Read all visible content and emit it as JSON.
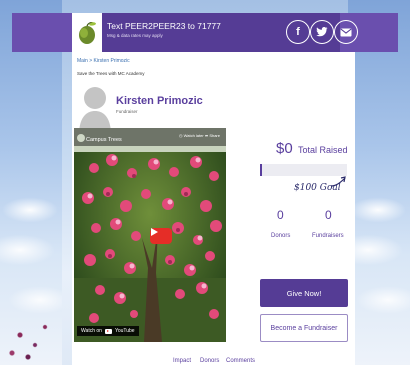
{
  "header": {
    "text_line1": "Text PEER2PEER23 to 71777",
    "text_line2": "Msg & data rates may apply",
    "social": [
      {
        "name": "facebook",
        "glyph": "f"
      },
      {
        "name": "twitter",
        "glyph": "t"
      },
      {
        "name": "email",
        "glyph": "@"
      }
    ]
  },
  "breadcrumb": {
    "root": "Main",
    "sep": ">",
    "current": "Kirsten Primozic"
  },
  "campaign_title": "Save the Trees with MC Academy",
  "profile": {
    "name": "Kirsten Primozic",
    "role": "Fundraiser"
  },
  "video": {
    "title": "Campus Trees",
    "watch_later": "Watch later",
    "share": "Share",
    "watch_on": "Watch on",
    "platform": "YouTube"
  },
  "stats": {
    "raised_amount": "$0",
    "raised_label": "Total Raised",
    "progress_fraction": 0.0,
    "goal_note": "$100 Goal",
    "donors_count": "0",
    "donors_label": "Donors",
    "fundraisers_count": "0",
    "fundraisers_label": "Fundraisers"
  },
  "buttons": {
    "give": "Give Now!",
    "become": "Become a Fundraiser"
  },
  "tabs": [
    "Impact",
    "Donors",
    "Comments"
  ],
  "colors": {
    "brand_purple": "#553c95",
    "accent_purple": "#5a3f9e",
    "youtube_red": "#e52d27"
  }
}
